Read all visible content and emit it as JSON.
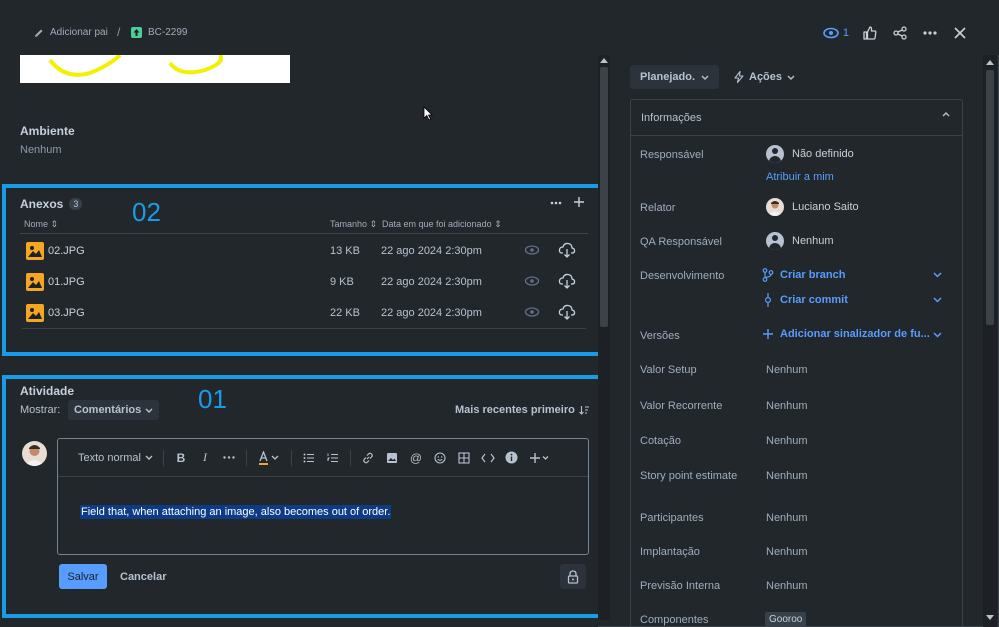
{
  "header": {
    "add_parent": "Adicionar pai",
    "separator": "/",
    "issue_key": "BC-2299",
    "watchers_count": "1"
  },
  "description": {
    "environment_title": "Ambiente",
    "environment_value": "Nenhum"
  },
  "attachments": {
    "title": "Anexos",
    "count": "3",
    "columns": {
      "name": "Nome",
      "size": "Tamanho",
      "date": "Data em que foi adicionado"
    },
    "rows": [
      {
        "name": "02.JPG",
        "size": "13 KB",
        "date": "22 ago 2024 2:30pm"
      },
      {
        "name": "01.JPG",
        "size": "9 KB",
        "date": "22 ago 2024 2:30pm"
      },
      {
        "name": "03.JPG",
        "size": "22 KB",
        "date": "22 ago 2024 2:30pm"
      }
    ]
  },
  "annotations": {
    "attachments_number": "02",
    "activity_number": "01"
  },
  "activity": {
    "title": "Atividade",
    "show_label": "Mostrar:",
    "filter": "Comentários",
    "sort": "Mais recentes primeiro",
    "editor": {
      "text_style": "Texto normal",
      "content": "Field that, when attaching an image, also becomes out of order."
    },
    "save": "Salvar",
    "cancel": "Cancelar"
  },
  "sidebar": {
    "status": "Planejado.",
    "actions": "Ações",
    "info_title": "Informações",
    "fields": {
      "assignee": {
        "label": "Responsável",
        "value": "Não definido",
        "link": "Atribuir a mim"
      },
      "reporter": {
        "label": "Relator",
        "value": "Luciano Saito"
      },
      "qa": {
        "label": "QA Responsável",
        "value": "Nenhum"
      },
      "development": {
        "label": "Desenvolvimento",
        "branch": "Criar branch",
        "commit": "Criar commit"
      },
      "versions": {
        "label": "Versões",
        "value": "Adicionar sinalizador de fu..."
      },
      "setup": {
        "label": "Valor Setup",
        "value": "Nenhum"
      },
      "recurring": {
        "label": "Valor Recorrente",
        "value": "Nenhum"
      },
      "quote": {
        "label": "Cotação",
        "value": "Nenhum"
      },
      "story_points": {
        "label": "Story point estimate",
        "value": "Nenhum"
      },
      "participants": {
        "label": "Participantes",
        "value": "Nenhum"
      },
      "deployment": {
        "label": "Implantação",
        "value": "Nenhum"
      },
      "internal_forecast": {
        "label": "Previsão Interna",
        "value": "Nenhum"
      },
      "components": {
        "label": "Componentes",
        "value": "Gooroo"
      }
    }
  },
  "colors": {
    "accent": "#579dff",
    "annotation": "#1a9be8",
    "background": "#22272b",
    "attachment_icon": "#f5a623"
  }
}
